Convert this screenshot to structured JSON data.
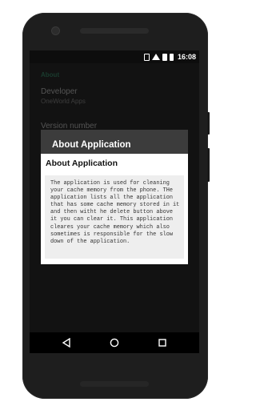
{
  "status_bar": {
    "time": "16:08",
    "icons": [
      "vibrate-icon",
      "wifi-icon",
      "sim-icon",
      "battery-icon"
    ]
  },
  "settings": {
    "section_header": "About",
    "developer": {
      "title": "Developer",
      "summary": "OneWorld Apps"
    },
    "version": {
      "title": "Version number"
    }
  },
  "dialog": {
    "outer_title": "About Application",
    "inner_title": "About Application",
    "message": "The application is used for cleaning your cache memory from the phone. THe application lists all the application that has some cache memory stored in it and then witht he delete button above it you can clear it. This application cleares your cache memory which also sometimes is responsible for the slow down of the application."
  },
  "nav_bar": {
    "buttons": [
      "back-icon",
      "home-icon",
      "recents-icon"
    ]
  },
  "colors": {
    "accent": "#2e6a52",
    "screen_bg": "#212121",
    "dialog_outer": "#3c3c3c",
    "message_bg": "#eeeeee"
  }
}
